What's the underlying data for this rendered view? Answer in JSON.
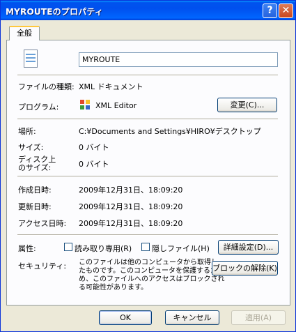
{
  "window": {
    "title": "MYROUTEのプロパティ",
    "help": "?",
    "close": "✕"
  },
  "tabs": [
    {
      "label": "全般"
    }
  ],
  "file": {
    "name": "MYROUTE"
  },
  "rows": {
    "type": {
      "label": "ファイルの種類:",
      "value": "XML ドキュメント"
    },
    "program": {
      "label": "プログラム:",
      "value": "XML Editor",
      "change_button": "変更(C)..."
    },
    "location": {
      "label": "場所:",
      "value": "C:¥Documents and Settings¥HIRO¥デスクトップ"
    },
    "size": {
      "label": "サイズ:",
      "value": "0 バイト"
    },
    "disksize": {
      "label1": "ディスク上",
      "label2": "のサイズ:",
      "value": "0 バイト"
    },
    "created": {
      "label": "作成日時:",
      "value": "2009年12月31日、18:09:20"
    },
    "modified": {
      "label": "更新日時:",
      "value": "2009年12月31日、18:09:20"
    },
    "accessed": {
      "label": "アクセス日時:",
      "value": "2009年12月31日、18:09:20"
    }
  },
  "attributes": {
    "label": "属性:",
    "readonly": "読み取り専用(R)",
    "hidden": "隠しファイル(H)",
    "advanced_button": "詳細設定(D)..."
  },
  "security": {
    "label": "セキュリティ:",
    "text_lines": [
      "このファイルは他のコンピュータから取得し",
      "たものです。このコンピュータを保護するた",
      "め、このファイルへのアクセスはブロックされ",
      "る可能性があります。"
    ],
    "unblock_button": "ブロックの解除(K)"
  },
  "footer": {
    "ok": "OK",
    "cancel": "キャンセル",
    "apply": "適用(A)"
  },
  "colors": {
    "titlebar": "#0053ee",
    "dialog_bg": "#ece9d8",
    "tab_highlight": "#ffc83c"
  },
  "icons": {
    "file": "xml-document-icon",
    "program": "xml-editor-icon"
  }
}
